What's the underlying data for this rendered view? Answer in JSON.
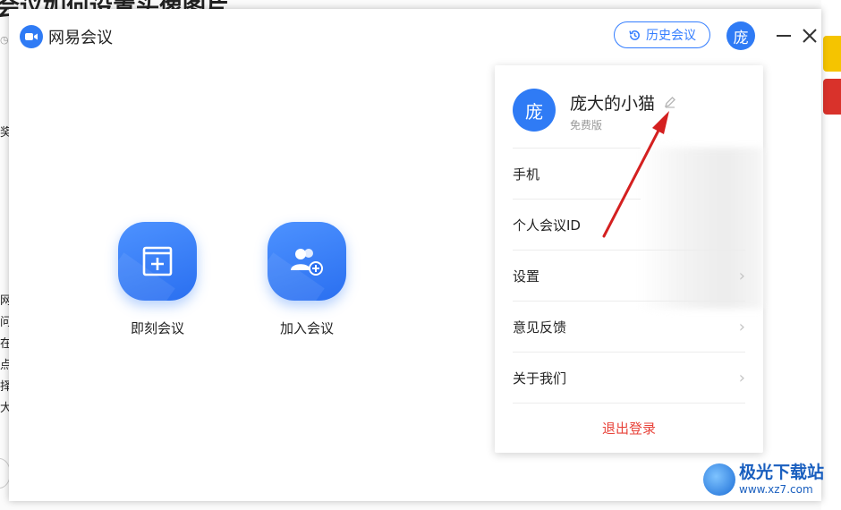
{
  "app": {
    "name": "网易会议",
    "history_button": "历史会议",
    "avatar_char": "庞"
  },
  "actions": [
    {
      "label": "即刻会议",
      "icon": "new-meeting-icon"
    },
    {
      "label": "加入会议",
      "icon": "join-meeting-icon"
    }
  ],
  "profile": {
    "avatar_char": "庞",
    "nickname": "庞大的小猫",
    "plan": "免费版",
    "rows": [
      {
        "label": "手机"
      },
      {
        "label": "个人会议ID"
      },
      {
        "label": "设置"
      },
      {
        "label": "意见反馈"
      },
      {
        "label": "关于我们"
      }
    ],
    "logout": "退出登录"
  },
  "watermark": {
    "name": "极光下载站",
    "url": "www.xz7.com"
  },
  "colors": {
    "accent": "#2f7bf5",
    "logout": "#e8433a",
    "annotation": "#d42020"
  }
}
